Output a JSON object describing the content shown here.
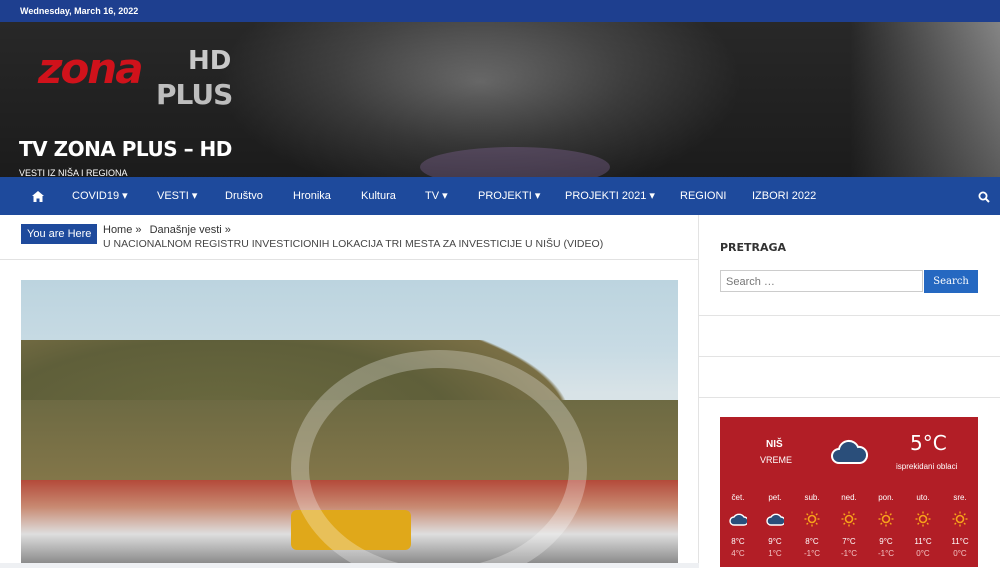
{
  "topbar": {
    "date": "Wednesday, March 16, 2022"
  },
  "header": {
    "logo_main": "zona",
    "logo_hd": "HD",
    "logo_plus": "PLUS",
    "site_title": "TV ZONA PLUS – HD",
    "tagline": "VESTI IZ NIŠA I REGIONA"
  },
  "nav": {
    "items": [
      "COVID19 ▾",
      "VESTI ▾",
      "Društvo",
      "Hronika",
      "Kultura",
      "TV ▾",
      "PROJEKTI ▾",
      "PROJEKTI 2021 ▾",
      "REGIONI",
      "IZBORI 2022"
    ]
  },
  "breadcrumb": {
    "pill": "You are Here",
    "home": "Home »",
    "category": "Današnje vesti »",
    "current": "U NACIONALNOM REGISTRU INVESTICIONIH LOKACIJA TRI MESTA ZA INVESTICIJE U NIŠU (VIDEO)"
  },
  "sidebar": {
    "search_title": "PRETRAGA",
    "search_placeholder": "Search …",
    "search_button": "Search"
  },
  "weather": {
    "city": "NIŠ",
    "label": "VREME",
    "temp": "5°C",
    "desc": "isprekidani oblaci",
    "days": [
      {
        "name": "čet.",
        "icon": "cloud-icon",
        "hi": "8°C",
        "lo": "4°C"
      },
      {
        "name": "pet.",
        "icon": "cloud-icon",
        "hi": "9°C",
        "lo": "1°C"
      },
      {
        "name": "sub.",
        "icon": "sun-icon",
        "hi": "8°C",
        "lo": "-1°C"
      },
      {
        "name": "ned.",
        "icon": "sun-icon",
        "hi": "7°C",
        "lo": "-1°C"
      },
      {
        "name": "pon.",
        "icon": "sun-icon",
        "hi": "9°C",
        "lo": "-1°C"
      },
      {
        "name": "uto.",
        "icon": "sun-icon",
        "hi": "11°C",
        "lo": "0°C"
      },
      {
        "name": "sre.",
        "icon": "sun-icon",
        "hi": "11°C",
        "lo": "0°C"
      }
    ]
  },
  "colors": {
    "nav": "#1e4a9c",
    "accent_red": "#b21e26",
    "logo_red": "#d0121b"
  }
}
